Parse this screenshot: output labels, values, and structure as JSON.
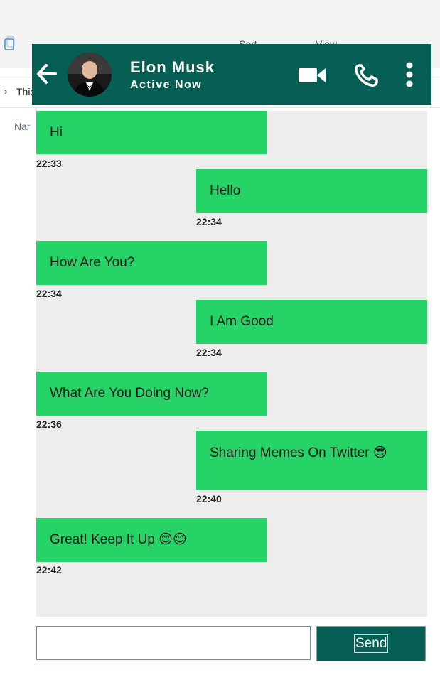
{
  "background": {
    "address_text": "This",
    "column_header": "Nar",
    "toolbar": {
      "sort_label": "Sort",
      "view_label": "View"
    }
  },
  "header": {
    "contact_name": "Elon Musk",
    "status": "Active Now",
    "colors": {
      "header_bg": "#075e54",
      "bubble": "#25d366",
      "chat_bg": "#ededed"
    }
  },
  "messages": [
    {
      "side": "left",
      "text": "Hi",
      "time": "22:33"
    },
    {
      "side": "right",
      "text": "Hello",
      "time": "22:34"
    },
    {
      "side": "left",
      "text": "How Are You?",
      "time": "22:34"
    },
    {
      "side": "right",
      "text": "I Am Good",
      "time": "22:34"
    },
    {
      "side": "left",
      "text": "What Are You Doing Now?",
      "time": "22:36"
    },
    {
      "side": "right",
      "text": "Sharing Memes On Twitter 😎",
      "time": "22:40"
    },
    {
      "side": "left",
      "text": "Great! Keep It Up 😊😊",
      "time": "22:42"
    }
  ],
  "composer": {
    "input_value": "",
    "send_label": "Send"
  },
  "icons": [
    "back-arrow-icon",
    "avatar",
    "video-call-icon",
    "phone-call-icon",
    "more-vertical-icon"
  ]
}
